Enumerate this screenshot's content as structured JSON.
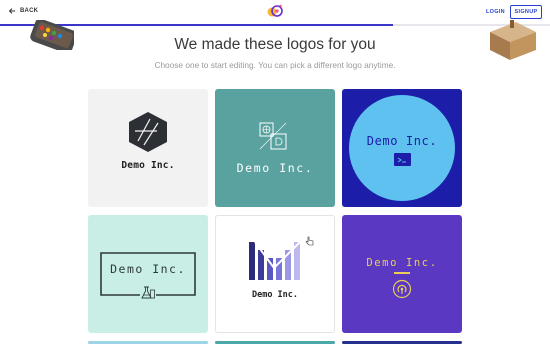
{
  "nav": {
    "back_label": "BACK",
    "login_label": "LOGIN",
    "signup_label": "SIGNUP"
  },
  "progress": {
    "fraction": 0.715,
    "color": "#3b35c9"
  },
  "main": {
    "heading": "We made these logos for you",
    "subheading": "Choose one to start editing. You can pick a different logo anytime."
  },
  "logos": [
    {
      "name": "Demo Inc.",
      "background": "#f2f2f2",
      "icon": "hexagon-icon"
    },
    {
      "name": "Demo Inc.",
      "background": "#5aa2a0",
      "icon": "globe-document-icon"
    },
    {
      "name": "Demo Inc.",
      "background": "#1c1da9",
      "icon": "terminal-icon"
    },
    {
      "name": "Demo Inc.",
      "background": "#c8eee5",
      "icon": "lab-flask-icon"
    },
    {
      "name": "Demo Inc.",
      "background": "#ffffff",
      "icon": "bar-m-icon"
    },
    {
      "name": "Demo Inc.",
      "background": "#5a38c2",
      "icon": "broadcast-icon"
    }
  ]
}
